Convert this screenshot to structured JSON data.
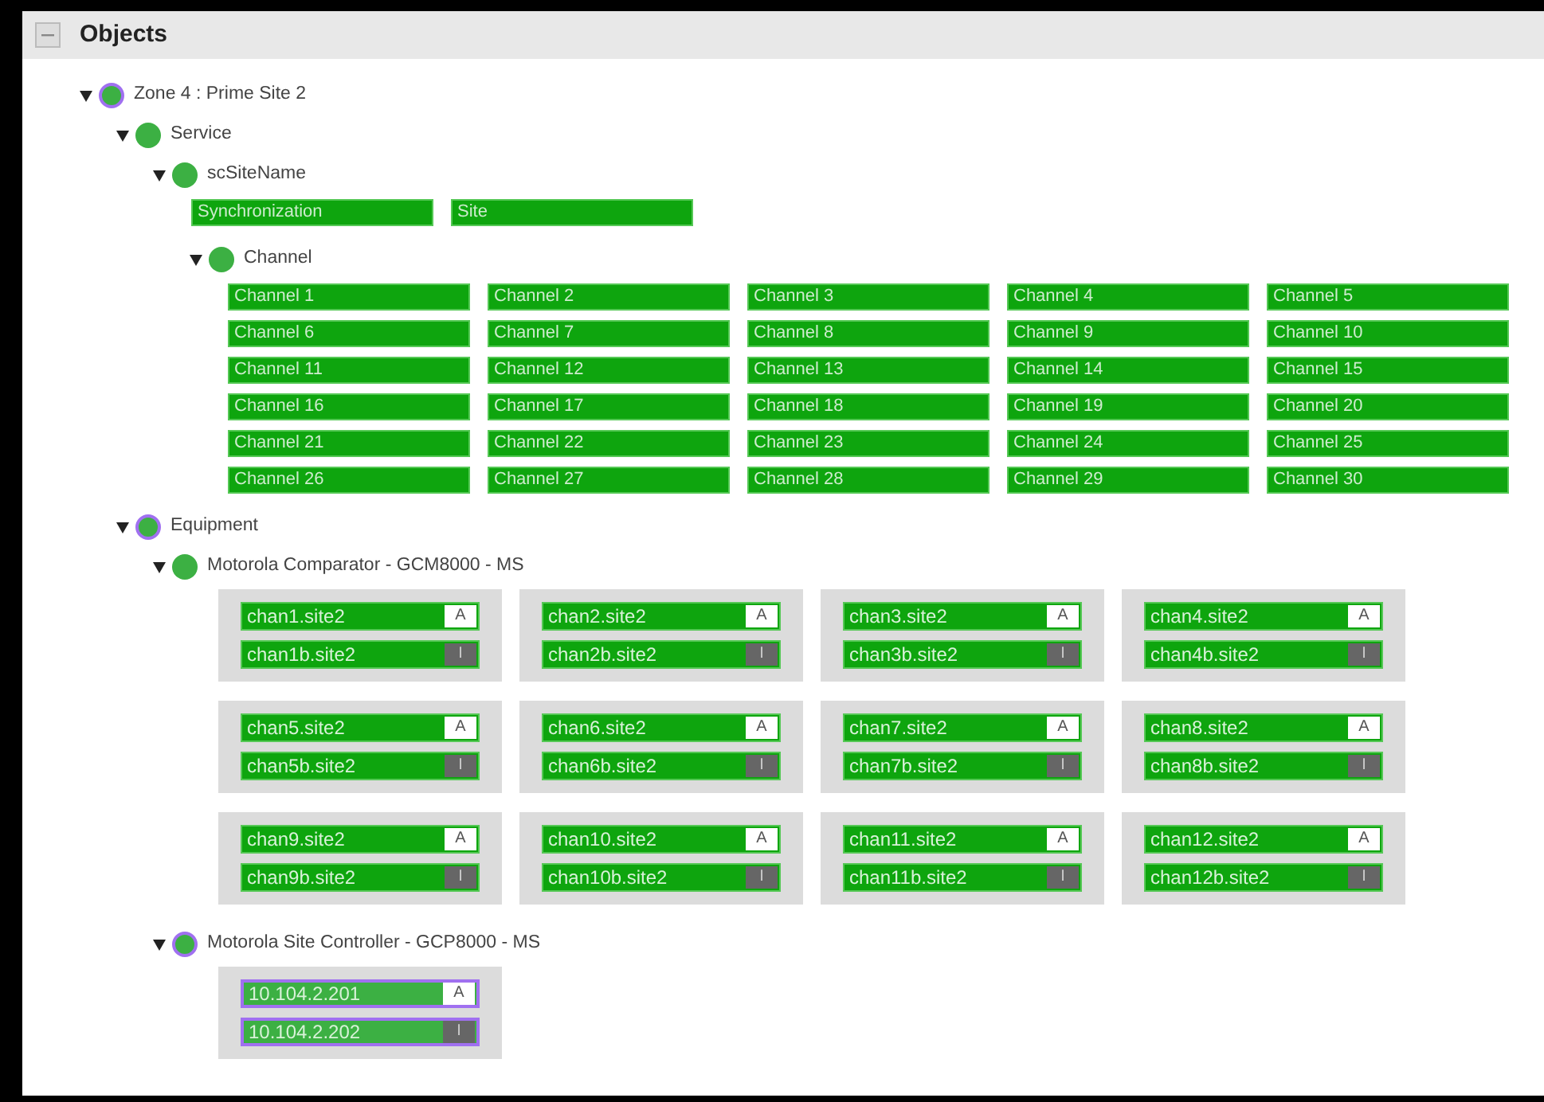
{
  "panel": {
    "title": "Objects",
    "expanded": true
  },
  "tree": [
    {
      "label": "Zone 4 : Prime Site 2",
      "expanded": true,
      "highlighted": true,
      "children": [
        {
          "label": "Service",
          "expanded": true,
          "highlighted": false,
          "children": [
            {
              "label": "scSiteName",
              "expanded": true,
              "highlighted": false,
              "tiles": [
                "Synchronization",
                "Site"
              ],
              "children": [
                {
                  "label": "Channel",
                  "expanded": true,
                  "highlighted": false,
                  "tiles": [
                    "Channel 1",
                    "Channel 2",
                    "Channel 3",
                    "Channel 4",
                    "Channel 5",
                    "Channel 6",
                    "Channel 7",
                    "Channel 8",
                    "Channel 9",
                    "Channel 10",
                    "Channel 11",
                    "Channel 12",
                    "Channel 13",
                    "Channel 14",
                    "Channel 15",
                    "Channel 16",
                    "Channel 17",
                    "Channel 18",
                    "Channel 19",
                    "Channel 20",
                    "Channel 21",
                    "Channel 22",
                    "Channel 23",
                    "Channel 24",
                    "Channel 25",
                    "Channel 26",
                    "Channel 27",
                    "Channel 28",
                    "Channel 29",
                    "Channel 30"
                  ]
                }
              ]
            }
          ]
        },
        {
          "label": "Equipment",
          "expanded": true,
          "highlighted": true,
          "children": [
            {
              "label": "Motorola Comparator - GCM8000 - MS",
              "expanded": true,
              "highlighted": false,
              "units": [
                {
                  "links": [
                    {
                      "label": "chan1.site2",
                      "mode": "A",
                      "active": true,
                      "highlighted": false
                    },
                    {
                      "label": "chan1b.site2",
                      "mode": "I",
                      "active": false,
                      "highlighted": false
                    }
                  ]
                },
                {
                  "links": [
                    {
                      "label": "chan2.site2",
                      "mode": "A",
                      "active": true,
                      "highlighted": false
                    },
                    {
                      "label": "chan2b.site2",
                      "mode": "I",
                      "active": false,
                      "highlighted": false
                    }
                  ]
                },
                {
                  "links": [
                    {
                      "label": "chan3.site2",
                      "mode": "A",
                      "active": true,
                      "highlighted": false
                    },
                    {
                      "label": "chan3b.site2",
                      "mode": "I",
                      "active": false,
                      "highlighted": false
                    }
                  ]
                },
                {
                  "links": [
                    {
                      "label": "chan4.site2",
                      "mode": "A",
                      "active": true,
                      "highlighted": false
                    },
                    {
                      "label": "chan4b.site2",
                      "mode": "I",
                      "active": false,
                      "highlighted": false
                    }
                  ]
                },
                {
                  "links": [
                    {
                      "label": "chan5.site2",
                      "mode": "A",
                      "active": true,
                      "highlighted": false
                    },
                    {
                      "label": "chan5b.site2",
                      "mode": "I",
                      "active": false,
                      "highlighted": false
                    }
                  ]
                },
                {
                  "links": [
                    {
                      "label": "chan6.site2",
                      "mode": "A",
                      "active": true,
                      "highlighted": false
                    },
                    {
                      "label": "chan6b.site2",
                      "mode": "I",
                      "active": false,
                      "highlighted": false
                    }
                  ]
                },
                {
                  "links": [
                    {
                      "label": "chan7.site2",
                      "mode": "A",
                      "active": true,
                      "highlighted": false
                    },
                    {
                      "label": "chan7b.site2",
                      "mode": "I",
                      "active": false,
                      "highlighted": false
                    }
                  ]
                },
                {
                  "links": [
                    {
                      "label": "chan8.site2",
                      "mode": "A",
                      "active": true,
                      "highlighted": false
                    },
                    {
                      "label": "chan8b.site2",
                      "mode": "I",
                      "active": false,
                      "highlighted": false
                    }
                  ]
                },
                {
                  "links": [
                    {
                      "label": "chan9.site2",
                      "mode": "A",
                      "active": true,
                      "highlighted": false
                    },
                    {
                      "label": "chan9b.site2",
                      "mode": "I",
                      "active": false,
                      "highlighted": false
                    }
                  ]
                },
                {
                  "links": [
                    {
                      "label": "chan10.site2",
                      "mode": "A",
                      "active": true,
                      "highlighted": false
                    },
                    {
                      "label": "chan10b.site2",
                      "mode": "I",
                      "active": false,
                      "highlighted": false
                    }
                  ]
                },
                {
                  "links": [
                    {
                      "label": "chan11.site2",
                      "mode": "A",
                      "active": true,
                      "highlighted": false
                    },
                    {
                      "label": "chan11b.site2",
                      "mode": "I",
                      "active": false,
                      "highlighted": false
                    }
                  ]
                },
                {
                  "links": [
                    {
                      "label": "chan12.site2",
                      "mode": "A",
                      "active": true,
                      "highlighted": false
                    },
                    {
                      "label": "chan12b.site2",
                      "mode": "I",
                      "active": false,
                      "highlighted": false
                    }
                  ]
                }
              ]
            },
            {
              "label": "Motorola Site Controller - GCP8000 - MS",
              "expanded": true,
              "highlighted": true,
              "units": [
                {
                  "links": [
                    {
                      "label": "10.104.2.201",
                      "mode": "A",
                      "active": true,
                      "highlighted": true
                    },
                    {
                      "label": "10.104.2.202",
                      "mode": "I",
                      "active": false,
                      "highlighted": true
                    }
                  ]
                }
              ]
            }
          ]
        }
      ]
    }
  ]
}
